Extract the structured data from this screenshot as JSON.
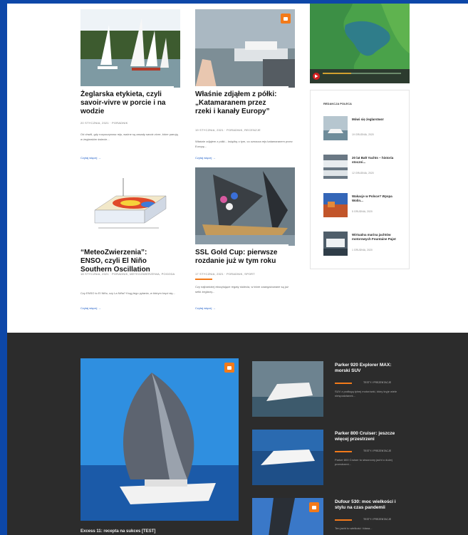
{
  "articles": [
    {
      "title": "Żeglarska etykieta, czyli savoir-vivre w porcie i na wodzie",
      "meta": "20 STYCZNIA, 2021  ·  PORADNIK",
      "desc": "Od chwili, gdy rozpoczynasz rejs, ważne są zasady savoir-vivre, które panują w żeglarskim świecie...",
      "more": "Czytaj więcej  →"
    },
    {
      "title": "Właśnie zdjąłem z półki: „Katamaranem przez rzeki i kanały Europy”",
      "meta": "19 STYCZNIA, 2021  ·  PORADNIK, RECENZJE",
      "desc": "Właśnie zdjąłem z półki... książkę o tym, co oznacza rejs katamaranem przez Europę...",
      "more": "Czytaj więcej  →"
    },
    {
      "title": "“MeteoZwierzenia”: ENSO, czyli El Niño Southern Oscillation",
      "meta": "18 STYCZNIA, 2021  ·  PORADNIK, METEOZWIERZENIA, POGODA",
      "desc": "Czy ENSO to El Niño, czy La Niña? Krąg tego pytania, w którym kręci się...",
      "more": "Czytaj więcej  →"
    },
    {
      "title": "SSL Gold Cup: pierwsze rozdanie już w tym roku",
      "meta": "17 STYCZNIA, 2021  ·  PORADNIK, SPORT",
      "desc": "Czy najbardziej ekscytujące regaty stulecia, w które zaangażowane są już setki żeglarzy...",
      "more": "Czytaj więcej  →"
    }
  ],
  "sidebar": {
    "title": "REDAKCJA POLECA",
    "items": [
      {
        "title": "Mówi się żeglarstwo!",
        "meta": "19 GRUDNIA, 2020"
      },
      {
        "title": "20 lat Bałt Yachts – historia stoczni...",
        "meta": "12 GRUDNIA, 2020"
      },
      {
        "title": "Wakacje w Polsce? Wyspa Wolin...",
        "meta": "5 GRUDNIA, 2020"
      },
      {
        "title": "Wirtualna marina jachtów motorowych Fountaine Pajot",
        "meta": "1 GRUDNIA, 2020"
      }
    ]
  },
  "dark": {
    "big_title": "Excess 11: recepta na sukces [TEST]",
    "items": [
      {
        "title": "Parker 920 Explorer MAX: morski SUV",
        "meta": "TESTY I PREZENTACJE",
        "desc": "SUV z podłogą tylnej motorówki, który kryje wiele niespodzianek..."
      },
      {
        "title": "Parker 800 Cruiser: jeszcze więcej przestrzeni",
        "meta": "TESTY I PREZENTACJE",
        "desc": "Parker 800 Cruiser to stworzony jacht o dużej przestrzeni..."
      },
      {
        "title": "Dufour 530: moc wielkości i stylu na czas pandemii",
        "meta": "TESTY I PREZENTACJE",
        "desc": "Ten jacht to wielkość i klasa..."
      }
    ]
  },
  "colors": {
    "accent": "#f27a1a",
    "frame": "#0d47a8",
    "dark": "#2c2c2c"
  }
}
